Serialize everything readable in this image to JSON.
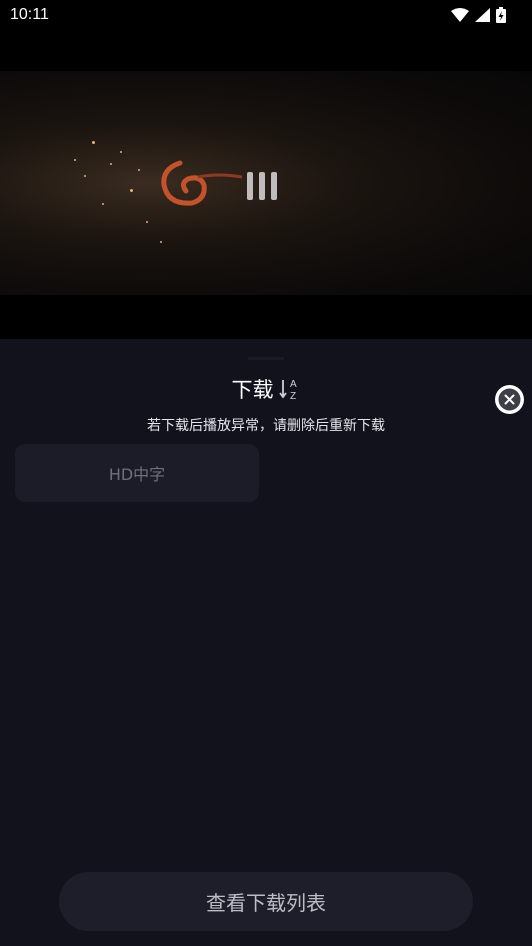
{
  "status_bar": {
    "time": "10:11",
    "icons": [
      "wifi-icon",
      "signal-icon",
      "battery-charging-icon"
    ]
  },
  "player": {
    "state_icon": "pause-icon",
    "logo": "studio-logo"
  },
  "panel": {
    "title": "下载",
    "sort_icon": "sort-az-icon",
    "hint": "若下载后播放异常，请删除后重新下载",
    "close_icon": "close-circle-icon",
    "quality_options": [
      "HD中字"
    ],
    "view_list_label": "查看下载列表"
  },
  "colors": {
    "background": "#12121d",
    "chip": "#1c1c29",
    "button": "#1e1e2b",
    "accent_logo": "#c4522a"
  }
}
